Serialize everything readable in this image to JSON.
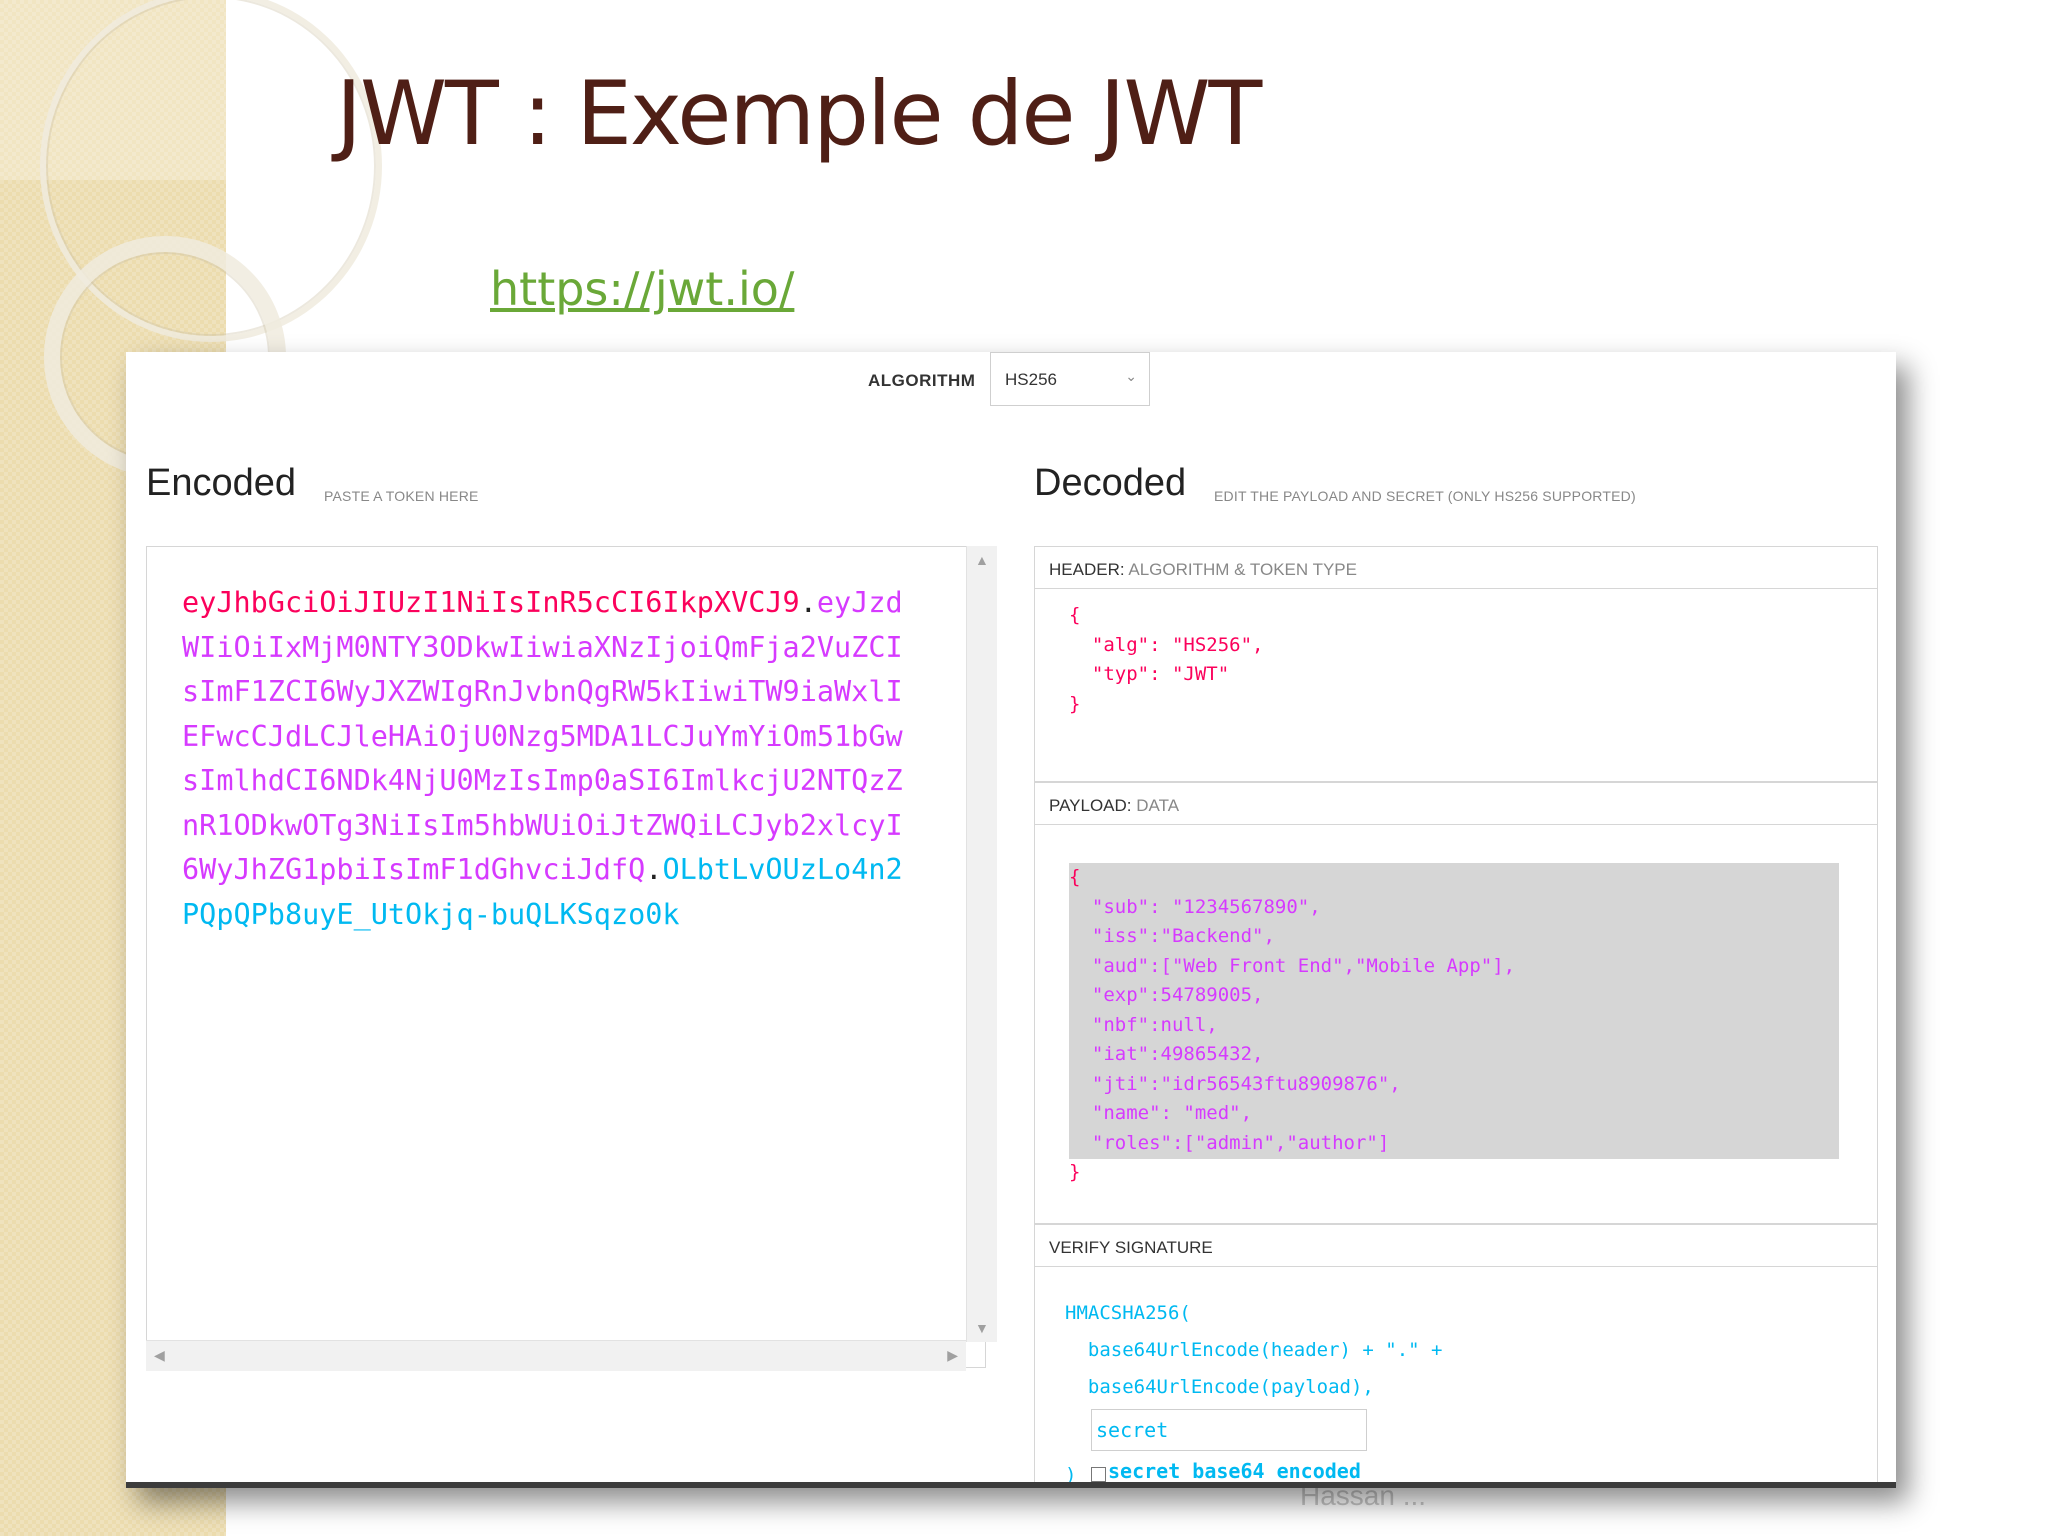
{
  "slide": {
    "title": "JWT : Exemple de JWT",
    "link": "https://jwt.io/",
    "footer": "Hassan ..."
  },
  "toolbar": {
    "algorithm_label": "ALGORITHM",
    "algorithm_value": "HS256"
  },
  "encoded": {
    "heading": "Encoded",
    "subheading": "PASTE A TOKEN HERE",
    "token_header": "eyJhbGciOiJIUzI1NiIsInR5cCI6IkpXVCJ9",
    "token_payload": "eyJzdWIiOiIxMjM0NTY3ODkwIiwiaXNzIjoiQmFja2VuZCIsImF1ZCI6WyJXZWIgRnJvbnQgRW5kIiwiTW9iaWxlIEFwcCJdLCJleHAiOjU0Nzg5MDA1LCJuYmYiOm51bGwsImlhdCI6NDk4NjU0MzIsImp0aSI6ImlkcjU2NTQzZnR1ODkwOTg3NiIsIm5hbWUiOiJtZWQiLCJyb2xlcyI6WyJhZG1pbiIsImF1dGhvciJdfQ",
    "token_signature": "OLbtLvOUzLo4n2PQpQPb8uyE_UtOkjq-buQLKSqzo0k",
    "dot": "."
  },
  "decoded": {
    "heading": "Decoded",
    "subheading": "EDIT THE PAYLOAD AND SECRET (ONLY HS256 SUPPORTED)",
    "header_section": {
      "label": "HEADER:",
      "sub": "ALGORITHM & TOKEN TYPE"
    },
    "payload_section": {
      "label": "PAYLOAD:",
      "sub": "DATA"
    },
    "signature_section": {
      "label": "VERIFY SIGNATURE"
    },
    "header_lines": [
      [
        "{",
        ""
      ],
      [
        "  \"alg\"",
        ": \"HS256\","
      ],
      [
        "  \"typ\"",
        ": \"JWT\""
      ],
      [
        "}",
        ""
      ]
    ],
    "payload_lines": [
      [
        "{",
        ""
      ],
      [
        "  \"sub\"",
        ": \"1234567890\","
      ],
      [
        "  \"iss\"",
        ":\"Backend\","
      ],
      [
        "  \"aud\"",
        ":[\"Web Front End\",\"Mobile App\"],"
      ],
      [
        "  \"exp\"",
        ":54789005,"
      ],
      [
        "  \"nbf\"",
        ":null,"
      ],
      [
        "  \"iat\"",
        ":49865432,"
      ],
      [
        "  \"jti\"",
        ":\"idr56543ftu8909876\","
      ],
      [
        "  \"name\"",
        ": \"med\","
      ],
      [
        "  \"roles\"",
        ":[\"admin\",\"author\"]"
      ],
      [
        "}",
        ""
      ]
    ],
    "signature_lines": [
      "HMACSHA256(",
      "  base64UrlEncode(header) + \".\" +",
      "  base64UrlEncode(payload),"
    ],
    "signature_close": ")",
    "secret_value": "secret",
    "secret_b64_label": "secret base64 encoded"
  },
  "colors": {
    "title": "#4f1f16",
    "link": "#6aa838",
    "token_header": "#fb015b",
    "token_payload": "#d63aff",
    "token_signature": "#00b9f1"
  }
}
